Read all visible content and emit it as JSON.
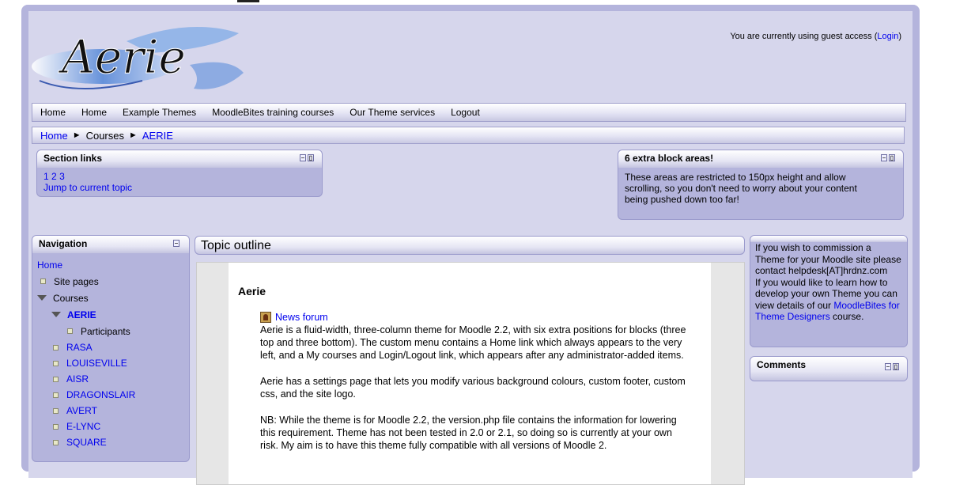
{
  "header": {
    "logo_text": "Aerie",
    "login_prefix": "You are currently using guest access (",
    "login_link": "Login",
    "login_suffix": ")"
  },
  "custom_menu": [
    "Home",
    "Home",
    "Example Themes",
    "MoodleBites training courses",
    "Our Theme services",
    "Logout"
  ],
  "breadcrumb": {
    "home": "Home",
    "courses": "Courses",
    "current": "AERIE",
    "separator": "►"
  },
  "section_links": {
    "title": "Section links",
    "numbers": [
      "1",
      "2",
      "3"
    ],
    "jump": "Jump to current topic"
  },
  "extra_block": {
    "title": "6 extra block areas!",
    "text": "These areas are restricted to 150px height and allow scrolling, so you don't need to worry about your content being pushed down too far!"
  },
  "navigation": {
    "title": "Navigation",
    "home": "Home",
    "site_pages": "Site pages",
    "courses": "Courses",
    "aerie": "AERIE",
    "participants": "Participants",
    "course_list": [
      "RASA",
      "LOUISEVILLE",
      "AISR",
      "DRAGONSLAIR",
      "AVERT",
      "E-LYNC",
      "SQUARE"
    ]
  },
  "main": {
    "heading": "Topic outline",
    "section_title": "Aerie",
    "forum_link": "News forum",
    "paragraphs": [
      "Aerie is a fluid-width, three-column theme for Moodle 2.2, with six extra positions for blocks (three top and three bottom). The custom menu contains a Home link which always appears to the very left, and a My courses and Login/Logout link, which appears after any administrator-added items.",
      "Aerie has a settings page that lets you modify various background colours, custom footer, custom css, and the site logo.",
      "NB: While the theme is for Moodle 2.2, the version.php file contains the information for lowering this requirement. Theme has not been tested in 2.0 or 2.1, so doing so is currently at your own risk. My aim is to have this theme fully compatible with all versions of Moodle 2."
    ]
  },
  "commission_block": {
    "text1": "If you wish to commission a Theme for your Moodle site please contact helpdesk[AT]hrdnz.com",
    "text2": "If you would like to learn how to develop your own Theme you can view details of our ",
    "link": "MoodleBites for Theme Designers",
    "text3": " course."
  },
  "comments_block": {
    "title": "Comments"
  },
  "colors": {
    "frame": "#b4b4dc",
    "page_bg": "#d6d6ec",
    "link": "#0000ee"
  }
}
